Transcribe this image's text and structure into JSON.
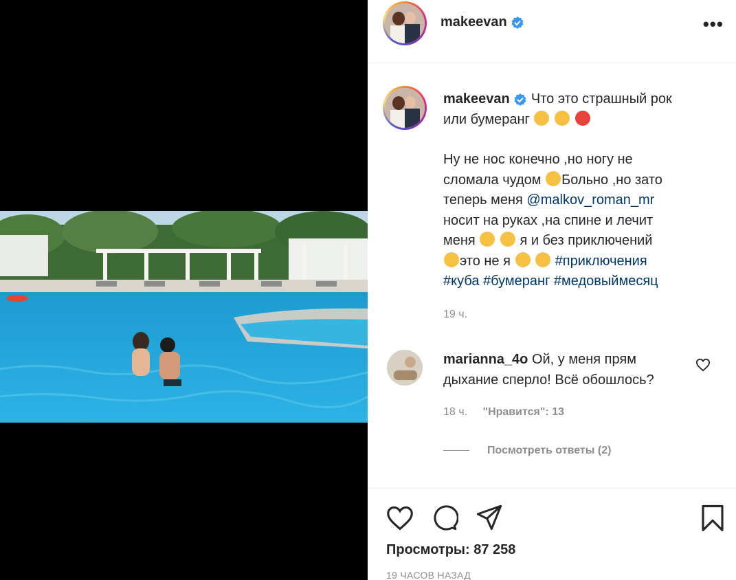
{
  "post": {
    "username": "makeevan",
    "more_label": "•••"
  },
  "caption": {
    "username": "makeevan",
    "line1": "Что это страшный рок",
    "line2": "или бумеранг",
    "p2_a": "Ну не нос конечно ,но ногу не",
    "p2_b": "сломала чудом",
    "p2_c": "Больно ,но зато",
    "p2_d": "теперь меня",
    "mention": "@malkov_roman_mr",
    "p2_e": "носит на руках ,на спине и лечит",
    "p2_f": "меня",
    "p2_g": "я и без приключений",
    "p2_h": "это не я",
    "tags1": "#приключения",
    "tags2": "#куба #бумеранг #медовыймесяц",
    "time": "19 ч."
  },
  "comment": {
    "username": "marianna_4o",
    "text1": "Ой, у меня прям",
    "text2": "дыхание сперло! Всё обошлось?",
    "time": "18 ч.",
    "likes": "\"Нравится\": 13",
    "view_replies": "Посмотреть ответы (2)"
  },
  "footer": {
    "views": "Просмотры: 87 258",
    "posted_ago": "19 ЧАСОВ НАЗАД"
  },
  "icons": {
    "like": "heart-icon",
    "comment": "comment-bubble-icon",
    "share": "paper-plane-icon",
    "save": "bookmark-icon",
    "verified": "verified-badge-icon"
  },
  "colors": {
    "verified": "#3897f0",
    "link": "#00376b",
    "muted": "#8e8e8e",
    "text": "#262626"
  }
}
